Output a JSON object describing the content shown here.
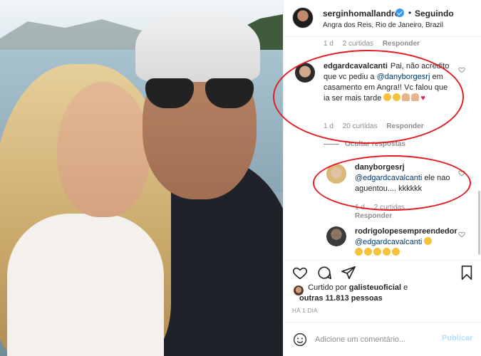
{
  "header": {
    "username": "serginhomallandro",
    "dot": "•",
    "follow_label": "Seguindo",
    "location": "Angra dos Reis, Rio de Janeiro, Brazil"
  },
  "top_meta": {
    "time": "1 d",
    "likes": "2 curtidas",
    "reply": "Responder"
  },
  "comment1": {
    "username": "edgardcavalcanti",
    "text_a": "Pai, não acredito que vc pediu a ",
    "mention": "@danyborgesrj",
    "text_b": " em casamento em Angra!! Vc falou que ia ser mais tarde",
    "time": "1 d",
    "likes": "20 curtidas",
    "reply": "Responder"
  },
  "view_replies": "Ocultar respostas",
  "comment2": {
    "username": "danyborgesrj",
    "mention": "@edgardcavalcanti",
    "text": " ele nao aguentou.... kkkkkk",
    "time": "1 d",
    "likes": "2 curtidas",
    "reply": "Responder"
  },
  "comment3": {
    "username": "rodrigolopesempreendedor",
    "mention": "@edgardcavalcanti"
  },
  "likes": {
    "prefix": "Curtido por ",
    "user": "galisteuoficial",
    "middle": " e",
    "others": "outras 11.813 pessoas"
  },
  "time_ago": "HÁ 1 DIA",
  "add_comment": {
    "placeholder": "Adicione um comentário...",
    "post_label": "Publicar"
  },
  "colors": {
    "link": "#00376b",
    "verified": "#3897f0",
    "highlight": "#e11d24",
    "post_disabled": "#b2dffc"
  }
}
